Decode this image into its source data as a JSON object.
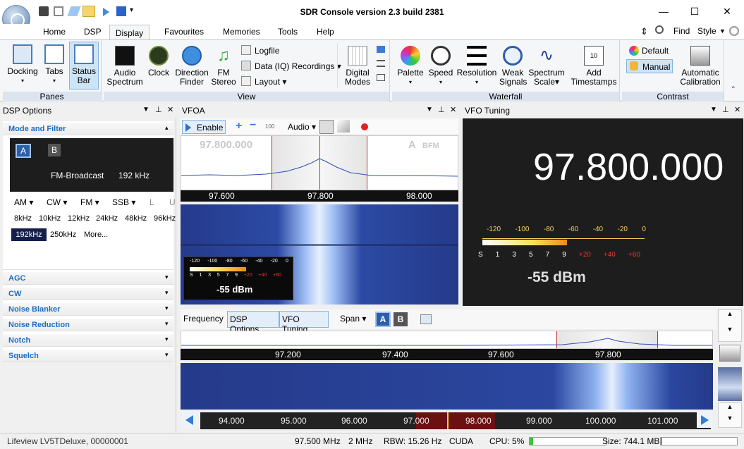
{
  "app": {
    "title": "SDR Console version 2.3 build 2381"
  },
  "window": {
    "minimize": "—",
    "maximize": "☐",
    "close": "✕"
  },
  "menu": {
    "tabs": [
      "Home",
      "DSP",
      "Display",
      "Favourites",
      "Memories",
      "Tools",
      "Help"
    ],
    "active": "Display",
    "find": "Find",
    "style": "Style"
  },
  "ribbon": {
    "panes": {
      "label": "Panes",
      "docking": "Docking",
      "tabs": "Tabs",
      "status1": "Status",
      "status2": "Bar"
    },
    "view": {
      "label": "View",
      "audio1": "Audio",
      "audio2": "Spectrum",
      "clock": "Clock",
      "direction1": "Direction",
      "direction2": "Finder",
      "fm1": "FM",
      "fm2": "Stereo",
      "logfile": "Logfile",
      "data_iq": "Data (IQ) Recordings",
      "layout": "Layout",
      "digital1": "Digital",
      "digital2": "Modes"
    },
    "waterfall": {
      "label": "Waterfall",
      "palette": "Palette",
      "speed": "Speed",
      "resolution": "Resolution",
      "weak1": "Weak",
      "weak2": "Signals",
      "spectrum1": "Spectrum",
      "spectrum2": "Scale",
      "add1": "Add",
      "add2": "Timestamps"
    },
    "contrast": {
      "label": "Contrast",
      "default": "Default",
      "manual": "Manual",
      "auto1": "Automatic",
      "auto2": "Calibration"
    }
  },
  "dsp_panel": {
    "title": "DSP Options",
    "mode_filter": "Mode and Filter",
    "vfo_a": "A",
    "vfo_b": "B",
    "mode": "FM-Broadcast",
    "bandwidth": "192 kHz",
    "modes": [
      "AM",
      "CW",
      "FM",
      "SSB",
      "L",
      "U"
    ],
    "filters": [
      "8kHz",
      "10kHz",
      "12kHz",
      "24kHz",
      "48kHz",
      "96kHz"
    ],
    "filters2": [
      "192kHz",
      "250kHz",
      "More..."
    ],
    "sections": [
      "AGC",
      "CW",
      "Noise Blanker",
      "Noise Reduction",
      "Notch",
      "Squelch"
    ]
  },
  "vfoa": {
    "title": "VFOA",
    "enable": "Enable",
    "zoom": "100",
    "audio": "Audio",
    "freq_ghost": "97.800.000",
    "mode_ghost": "A",
    "mode_ghost_sub": "BFM",
    "ticks": [
      "97.600",
      "97.800",
      "98.000"
    ],
    "meter_ticks": [
      "-120",
      "-100",
      "-80",
      "-60",
      "-40",
      "-20",
      "0"
    ],
    "meter_sub": [
      "S",
      "1",
      "3",
      "5",
      "7",
      "9",
      "+20",
      "+40",
      "+60"
    ],
    "dbm": "-55 dBm"
  },
  "vfo_tuning": {
    "title": "VFO Tuning",
    "frequency": "97.800.000",
    "meter_ticks": [
      "-120",
      "-100",
      "-80",
      "-60",
      "-40",
      "-20",
      "0"
    ],
    "meter_sub": [
      "S",
      "1",
      "3",
      "5",
      "7",
      "9",
      "+20",
      "+40",
      "+60"
    ],
    "dbm": "-55 dBm"
  },
  "bottom": {
    "tabs": [
      "Frequency",
      "DSP Options",
      "VFO Tuning"
    ],
    "span": "Span",
    "vfo_a": "A",
    "vfo_b": "B",
    "ticks": [
      "97.200",
      "97.400",
      "97.600",
      "97.800"
    ],
    "band_ticks": [
      "94.000",
      "95.000",
      "96.000",
      "97.000",
      "98.000",
      "99.000",
      "100.000",
      "101.000"
    ]
  },
  "status": {
    "device": "Lifeview LV5TDeluxe, 00000001",
    "center": "97.500 MHz",
    "bandwidth": "2 MHz",
    "rbw": "RBW: 15.26 Hz",
    "engine": "CUDA",
    "cpu": "CPU: 5%",
    "cpu_level": 0.05,
    "size": "Size: 744.1 MB",
    "size_level": 0.02
  }
}
